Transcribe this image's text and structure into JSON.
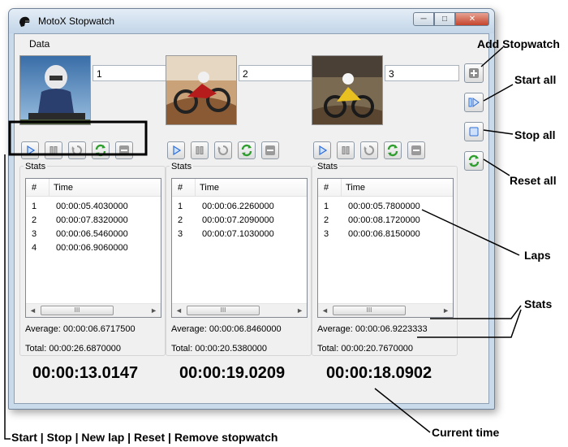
{
  "window": {
    "title": "MotoX Stopwatch",
    "minimize": "─",
    "maximize": "□",
    "close": "✕"
  },
  "menu": {
    "data": "Data"
  },
  "stopwatches": [
    {
      "name": "1",
      "stats_label": "Stats",
      "headers": {
        "number": "#",
        "time": "Time"
      },
      "laps": [
        {
          "n": "1",
          "t": "00:00:05.4030000"
        },
        {
          "n": "2",
          "t": "00:00:07.8320000"
        },
        {
          "n": "3",
          "t": "00:00:06.5460000"
        },
        {
          "n": "4",
          "t": "00:00:06.9060000"
        }
      ],
      "average": "Average: 00:00:06.6717500",
      "total": "Total: 00:00:26.6870000",
      "current": "00:00:13.0147",
      "scroll_thumb": "III"
    },
    {
      "name": "2",
      "stats_label": "Stats",
      "headers": {
        "number": "#",
        "time": "Time"
      },
      "laps": [
        {
          "n": "1",
          "t": "00:00:06.2260000"
        },
        {
          "n": "2",
          "t": "00:00:07.2090000"
        },
        {
          "n": "3",
          "t": "00:00:07.1030000"
        }
      ],
      "average": "Average: 00:00:06.8460000",
      "total": "Total: 00:00:20.5380000",
      "current": "00:00:19.0209",
      "scroll_thumb": "III"
    },
    {
      "name": "3",
      "stats_label": "Stats",
      "headers": {
        "number": "#",
        "time": "Time"
      },
      "laps": [
        {
          "n": "1",
          "t": "00:00:05.7800000"
        },
        {
          "n": "2",
          "t": "00:00:08.1720000"
        },
        {
          "n": "3",
          "t": "00:00:06.8150000"
        }
      ],
      "average": "Average: 00:00:06.9223333",
      "total": "Total: 00:00:20.7670000",
      "current": "00:00:18.0902",
      "scroll_thumb": "III"
    }
  ],
  "annotations": {
    "add_stopwatch": "Add Stopwatch",
    "start_all": "Start all",
    "stop_all": "Stop all",
    "reset_all": "Reset all",
    "laps": "Laps",
    "stats": "Stats",
    "current_time": "Current time",
    "toolbar_legend": "Start | Stop | New lap | Reset | Remove stopwatch"
  },
  "colors": {
    "accent_blue": "#2f6fd6",
    "reset_green": "#2e9e2e",
    "close_red": "#c4442c"
  }
}
